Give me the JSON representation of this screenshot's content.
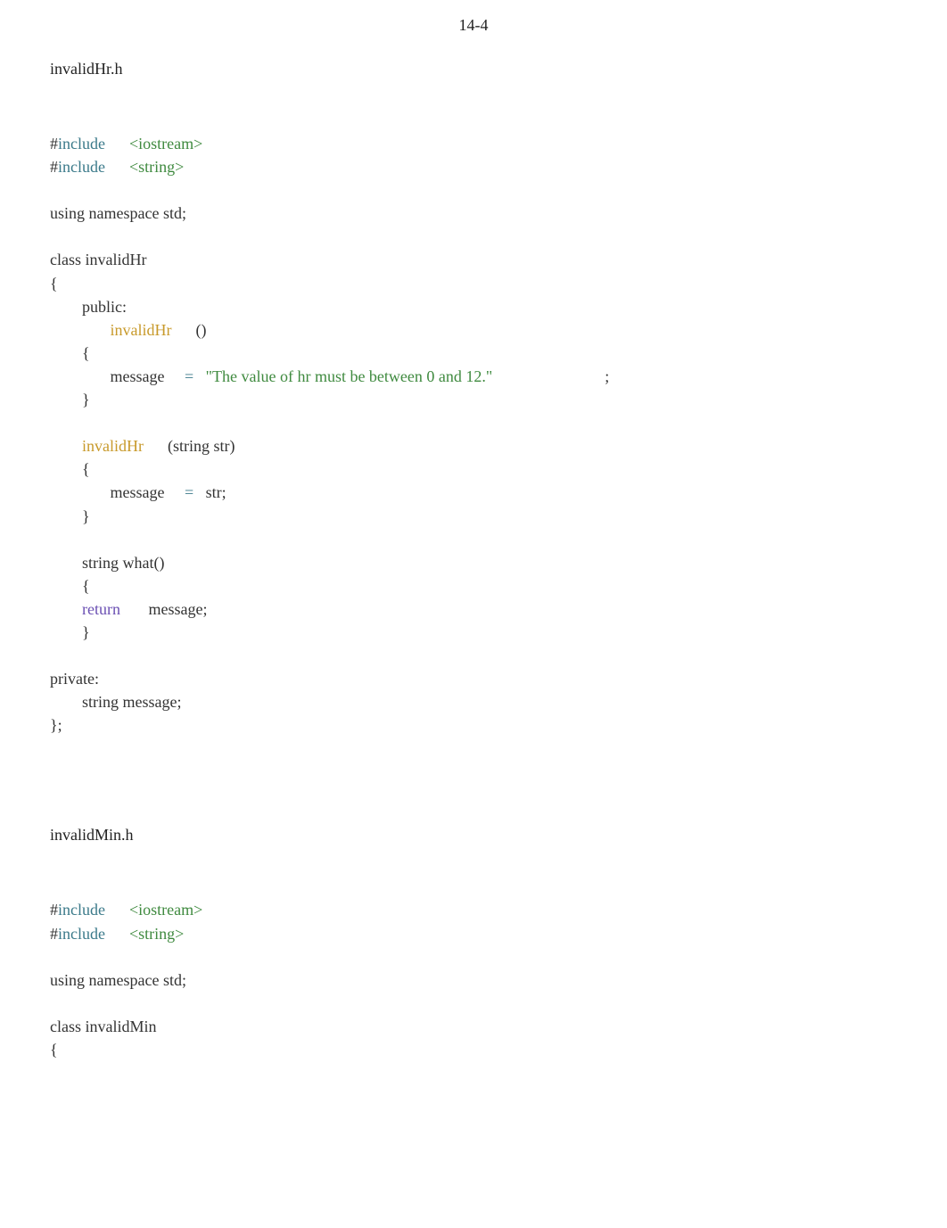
{
  "page_number": "14-4",
  "sections": [
    {
      "title": "invalidHr.h",
      "lines": [
        {
          "segments": [
            {
              "t": "#",
              "c": "plain"
            },
            {
              "t": "include",
              "c": "kw-include"
            },
            {
              "t": "      ",
              "c": "plain"
            },
            {
              "t": "<iostream>",
              "c": "hdr-green"
            }
          ]
        },
        {
          "segments": [
            {
              "t": "#",
              "c": "plain"
            },
            {
              "t": "include",
              "c": "kw-include"
            },
            {
              "t": "      ",
              "c": "plain"
            },
            {
              "t": "<string>",
              "c": "hdr-green"
            }
          ]
        },
        {
          "segments": []
        },
        {
          "segments": [
            {
              "t": "using namespace std;",
              "c": "plain"
            }
          ]
        },
        {
          "segments": []
        },
        {
          "segments": [
            {
              "t": "class invalidHr",
              "c": "plain"
            }
          ]
        },
        {
          "segments": [
            {
              "t": "{",
              "c": "plain"
            }
          ]
        },
        {
          "segments": [
            {
              "t": "        public:",
              "c": "plain"
            }
          ]
        },
        {
          "segments": [
            {
              "t": "               ",
              "c": "plain"
            },
            {
              "t": "invalidHr",
              "c": "fn-yellow"
            },
            {
              "t": "      ()",
              "c": "plain"
            }
          ]
        },
        {
          "segments": [
            {
              "t": "        {",
              "c": "plain"
            }
          ]
        },
        {
          "segments": [
            {
              "t": "               message     ",
              "c": "plain"
            },
            {
              "t": "=",
              "c": "op-teal"
            },
            {
              "t": "   ",
              "c": "plain"
            },
            {
              "t": "\"The value of hr must be between 0 and 12.\"",
              "c": "hdr-green"
            },
            {
              "t": "                            ;",
              "c": "plain"
            }
          ]
        },
        {
          "segments": [
            {
              "t": "        }",
              "c": "plain"
            }
          ]
        },
        {
          "segments": []
        },
        {
          "segments": [
            {
              "t": "        ",
              "c": "plain"
            },
            {
              "t": "invalidHr",
              "c": "fn-yellow"
            },
            {
              "t": "      (string str)",
              "c": "plain"
            }
          ]
        },
        {
          "segments": [
            {
              "t": "        {",
              "c": "plain"
            }
          ]
        },
        {
          "segments": [
            {
              "t": "               message     ",
              "c": "plain"
            },
            {
              "t": "=",
              "c": "op-teal"
            },
            {
              "t": "   str;",
              "c": "plain"
            }
          ]
        },
        {
          "segments": [
            {
              "t": "        }",
              "c": "plain"
            }
          ]
        },
        {
          "segments": []
        },
        {
          "segments": [
            {
              "t": "        string what()",
              "c": "plain"
            }
          ]
        },
        {
          "segments": [
            {
              "t": "        {",
              "c": "plain"
            }
          ]
        },
        {
          "segments": [
            {
              "t": "        ",
              "c": "plain"
            },
            {
              "t": "return",
              "c": "kw-purple"
            },
            {
              "t": "       message;",
              "c": "plain"
            }
          ]
        },
        {
          "segments": [
            {
              "t": "        }",
              "c": "plain"
            }
          ]
        },
        {
          "segments": []
        },
        {
          "segments": [
            {
              "t": "private:",
              "c": "plain"
            }
          ]
        },
        {
          "segments": [
            {
              "t": "        string message;",
              "c": "plain"
            }
          ]
        },
        {
          "segments": [
            {
              "t": "};",
              "c": "plain"
            }
          ]
        }
      ]
    },
    {
      "title": "invalidMin.h",
      "lines": [
        {
          "segments": [
            {
              "t": "#",
              "c": "plain"
            },
            {
              "t": "include",
              "c": "kw-include"
            },
            {
              "t": "      ",
              "c": "plain"
            },
            {
              "t": "<iostream>",
              "c": "hdr-green"
            }
          ]
        },
        {
          "segments": [
            {
              "t": "#",
              "c": "plain"
            },
            {
              "t": "include",
              "c": "kw-include"
            },
            {
              "t": "      ",
              "c": "plain"
            },
            {
              "t": "<string>",
              "c": "hdr-green"
            }
          ]
        },
        {
          "segments": []
        },
        {
          "segments": [
            {
              "t": "using namespace std;",
              "c": "plain"
            }
          ]
        },
        {
          "segments": []
        },
        {
          "segments": [
            {
              "t": "class invalidMin",
              "c": "plain"
            }
          ]
        },
        {
          "segments": [
            {
              "t": "{",
              "c": "plain"
            }
          ]
        }
      ]
    }
  ]
}
